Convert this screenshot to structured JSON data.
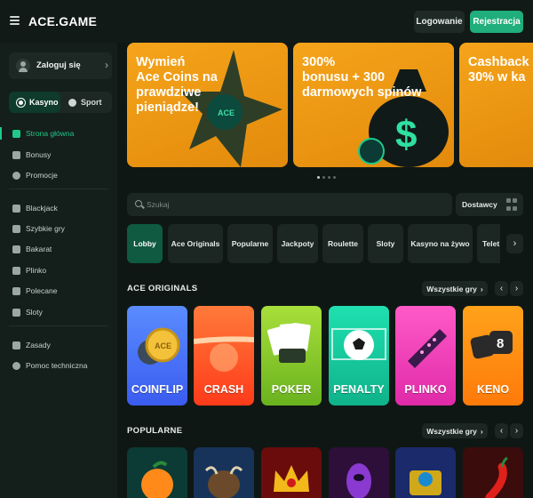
{
  "header": {
    "logo": "ACE.GAME",
    "login_label": "Logowanie",
    "register_label": "Rejestracja"
  },
  "sidebar": {
    "login_card_label": "Zaloguj się",
    "modes": [
      {
        "label": "Kasyno",
        "active": true
      },
      {
        "label": "Sport",
        "active": false
      }
    ],
    "nav_group1": [
      {
        "label": "Strona główna",
        "icon": "home-icon",
        "active": true
      },
      {
        "label": "Bonusy",
        "icon": "gift-icon",
        "active": false
      },
      {
        "label": "Promocje",
        "icon": "percent-icon",
        "active": false
      }
    ],
    "nav_group2": [
      {
        "label": "Blackjack",
        "icon": "cards-icon"
      },
      {
        "label": "Szybkie gry",
        "icon": "lightning-icon"
      },
      {
        "label": "Bakarat",
        "icon": "spade-icon"
      },
      {
        "label": "Plinko",
        "icon": "plinko-icon"
      },
      {
        "label": "Polecane",
        "icon": "thumbs-up-icon"
      },
      {
        "label": "Sloty",
        "icon": "slots-icon"
      }
    ],
    "nav_group3": [
      {
        "label": "Zasady",
        "icon": "document-icon"
      },
      {
        "label": "Pomoc techniczna",
        "icon": "headset-icon"
      }
    ]
  },
  "banners": [
    {
      "text": "Wymień\nAce Coins na\nprawdziwe\npieniądze!"
    },
    {
      "text": "300%\nbonusu + 300\ndarmowych spinów"
    },
    {
      "text": "Cashback\n30% w ka"
    }
  ],
  "search": {
    "placeholder": "Szukaj",
    "providers_label": "Dostawcy"
  },
  "categories": [
    {
      "label": "Lobby",
      "active": true
    },
    {
      "label": "Ace Originals",
      "active": false
    },
    {
      "label": "Popularne",
      "active": false
    },
    {
      "label": "Jackpoty",
      "active": false
    },
    {
      "label": "Roulette",
      "active": false
    },
    {
      "label": "Sloty",
      "active": false
    },
    {
      "label": "Kasyno na żywo",
      "active": false
    },
    {
      "label": "Telet",
      "active": false
    }
  ],
  "sections": {
    "originals_title": "ACE ORIGINALS",
    "popular_title": "POPULARNE",
    "all_games_label": "Wszystkie gry"
  },
  "originals": [
    {
      "name": "COINFLIP"
    },
    {
      "name": "CRASH"
    },
    {
      "name": "POKER"
    },
    {
      "name": "PENALTY"
    },
    {
      "name": "PLINKO"
    },
    {
      "name": "KENO"
    }
  ],
  "colors": {
    "accent": "#1fae7c",
    "background": "#0f1714",
    "banner_orange": "#f5a41a"
  }
}
